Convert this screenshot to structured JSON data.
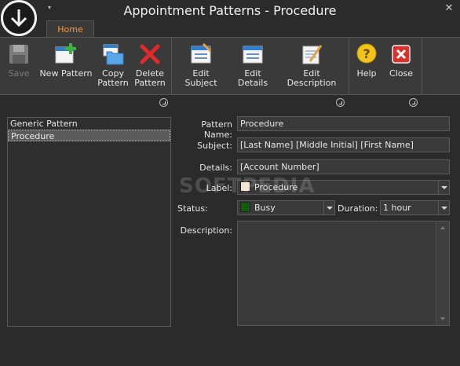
{
  "window": {
    "title": "Appointment Patterns - Procedure",
    "close_glyph": "✕",
    "qat_glyph": "▾"
  },
  "tabs": [
    {
      "label": "Home",
      "active": true
    }
  ],
  "ribbon": {
    "save": {
      "label": "Save",
      "icon": "save-disk-icon",
      "enabled": false
    },
    "new_pattern": {
      "label": "New Pattern",
      "icon": "new-document-plus-icon"
    },
    "copy_pattern": {
      "label_line1": "Copy",
      "label_line2": "Pattern",
      "icon": "copy-folder-icon"
    },
    "delete_pattern": {
      "label_line1": "Delete",
      "label_line2": "Pattern",
      "icon": "red-x-icon"
    },
    "edit_subject": {
      "label": "Edit Subject",
      "icon": "edit-form-icon"
    },
    "edit_details": {
      "label": "Edit Details",
      "icon": "edit-form-icon"
    },
    "edit_description": {
      "label": "Edit Description",
      "icon": "edit-notepad-icon"
    },
    "help": {
      "label": "Help",
      "icon": "help-question-icon"
    },
    "close": {
      "label": "Close",
      "icon": "close-red-icon"
    }
  },
  "patterns": {
    "items": [
      {
        "label": "Generic Pattern",
        "selected": false
      },
      {
        "label": "Procedure",
        "selected": true
      }
    ]
  },
  "form": {
    "pattern_name": {
      "label": "Pattern Name:",
      "value": "Procedure"
    },
    "subject": {
      "label": "Subject:",
      "value": "[Last Name] [Middle Initial] [First Name]"
    },
    "details": {
      "label": "Details:",
      "value": "[Account Number]"
    },
    "label": {
      "label": "Label:",
      "value": "Procedure",
      "swatch_color": "#f3e4cf"
    },
    "status": {
      "label": "Status:",
      "value": "Busy",
      "swatch_color": "#0f5c0f"
    },
    "duration": {
      "label": "Duration:",
      "value": "1 hour"
    },
    "description": {
      "label": "Description:",
      "value": ""
    }
  },
  "colors": {
    "accent_tab": "#ff9a2e"
  },
  "watermark": "SOFTPEDIA"
}
